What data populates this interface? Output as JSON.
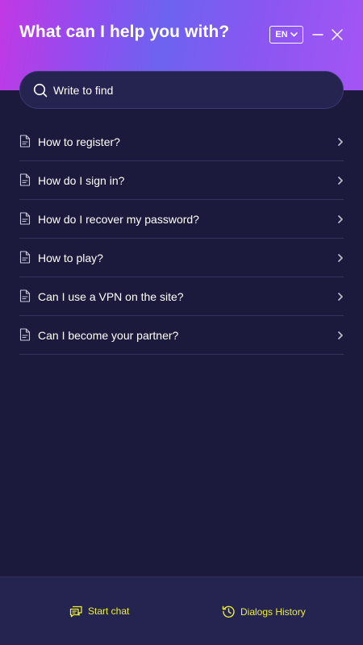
{
  "header": {
    "title": "What can I help you with?",
    "language": "EN",
    "gradient_colors": [
      "#c238e4",
      "#6d63f0",
      "#a455f4"
    ]
  },
  "search": {
    "placeholder": "Write to find"
  },
  "faq": [
    {
      "label": "How to register?"
    },
    {
      "label": "How do I sign in?"
    },
    {
      "label": "How do I recover my password?"
    },
    {
      "label": "How to play?"
    },
    {
      "label": "Can I use a VPN on the site?"
    },
    {
      "label": "Can I become your partner?"
    }
  ],
  "footer": {
    "start_chat": "Start chat",
    "dialogs_history": "Dialogs History",
    "accent_color": "#ecf03a"
  },
  "colors": {
    "background": "#1c1a3c",
    "panel": "#25234f",
    "divider": "#34325a"
  }
}
